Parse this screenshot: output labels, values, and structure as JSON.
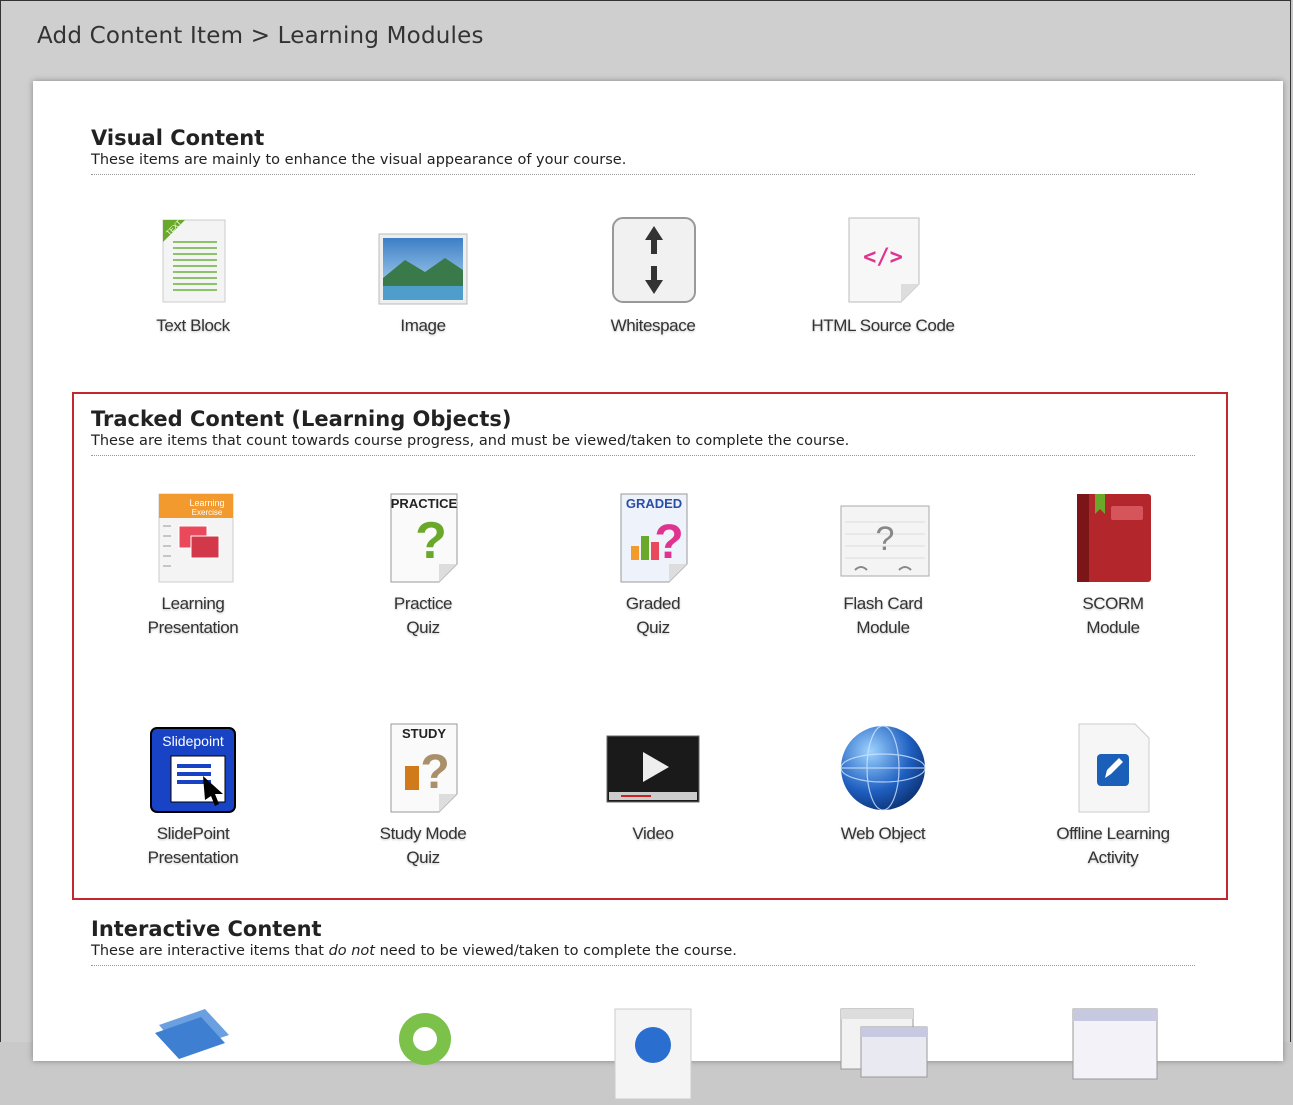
{
  "breadcrumb": "Add Content Item > Learning Modules",
  "sections": {
    "visual": {
      "title": "Visual Content",
      "desc": "These items are mainly to enhance the visual appearance of your course.",
      "items": [
        "Text Block",
        "Image",
        "Whitespace",
        "HTML Source Code"
      ]
    },
    "tracked": {
      "title": "Tracked Content (Learning Objects)",
      "desc": "These are items that count towards course progress, and must be viewed/taken to complete the course.",
      "row1": [
        [
          "Learning",
          "Presentation"
        ],
        [
          "Practice",
          "Quiz"
        ],
        [
          "Graded",
          "Quiz"
        ],
        [
          "Flash Card",
          "Module"
        ],
        [
          "SCORM",
          "Module"
        ]
      ],
      "row2": [
        [
          "SlidePoint",
          "Presentation"
        ],
        [
          "Study Mode",
          "Quiz"
        ],
        [
          "Video",
          ""
        ],
        [
          "Web Object",
          ""
        ],
        [
          "Offline Learning",
          "Activity"
        ]
      ],
      "icon_text": {
        "practice": "PRACTICE",
        "graded": "GRADED",
        "study": "STUDY",
        "slidepoint": "Slidepoint",
        "text_ribbon": "TEXT",
        "learning_ex": "Learning Exercise",
        "html": "</>",
        "flash": "?"
      }
    },
    "interactive": {
      "title": "Interactive Content",
      "desc_pre": "These are interactive items that ",
      "desc_em": "do not",
      "desc_post": " need to be viewed/taken to complete the course."
    }
  },
  "colors": {
    "highlight": "#c1272d",
    "accent_green": "#6aa82a",
    "accent_pink": "#e0338f"
  }
}
